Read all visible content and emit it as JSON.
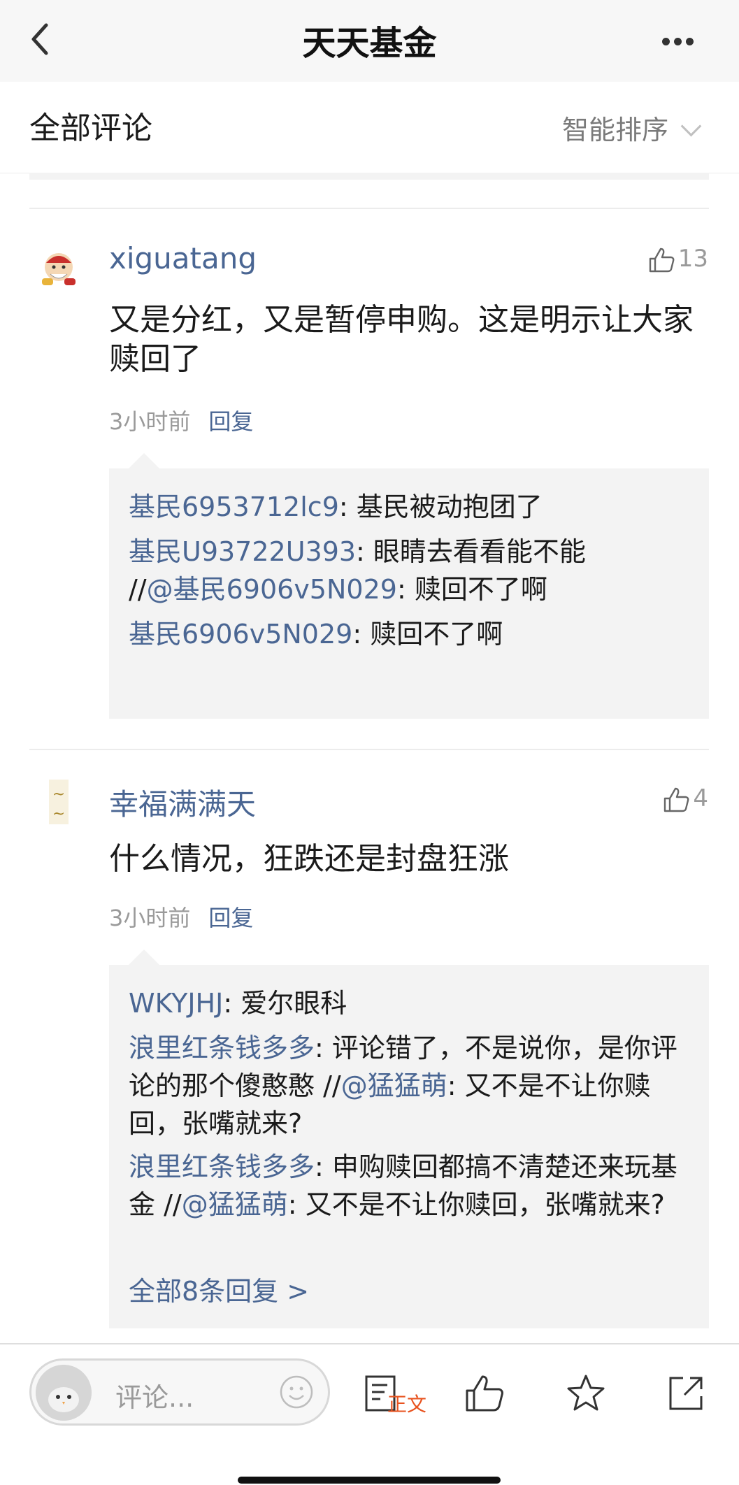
{
  "app": {
    "title": "天天基金"
  },
  "section": {
    "title": "全部评论",
    "sort_label": "智能排序"
  },
  "comments": [
    {
      "user": "xiguatang",
      "likes": "13",
      "content": "又是分红，又是暂停申购。这是明示让大家赎回了",
      "time": "3小时前",
      "reply_label": "回复",
      "replies": [
        {
          "user": "基民6953712lc9",
          "text": ": 基民被动抱团了"
        },
        {
          "user": "基民U93722U393",
          "text_1": ": 眼睛去看看能不能",
          "text_2": " //",
          "mention": "@基民6906v5N029",
          "text_3": ": 赎回不了啊"
        },
        {
          "user": "基民6906v5N029",
          "text": ": 赎回不了啊"
        }
      ]
    },
    {
      "user": "幸福满满天",
      "likes": "4",
      "content": "什么情况，狂跌还是封盘狂涨",
      "time": "3小时前",
      "reply_label": "回复",
      "replies": [
        {
          "user": "WKYJHJ",
          "text": ": 爱尔眼科"
        },
        {
          "user": "浪里红条钱多多",
          "text_1": ": 评论错了，不是说你，是你评论的那个傻憨憨 //",
          "mention": "@猛猛萌",
          "text_2": ": 又不是不让你赎回，张嘴就来?"
        },
        {
          "user": "浪里红条钱多多",
          "text_1": ": 申购赎回都搞不清楚还来玩基金 //",
          "mention": "@猛猛萌",
          "text_2": ": 又不是不让你赎回，张嘴就来?"
        }
      ],
      "all_replies": "全部8条回复 >"
    }
  ],
  "bottom_bar": {
    "comment_placeholder": "评论...",
    "article_label": "正文",
    "icons": [
      "emoji-icon",
      "article-icon",
      "like-icon",
      "star-icon",
      "share-icon"
    ]
  },
  "colors": {
    "link": "#4a6693",
    "accent": "#e8531f",
    "reply_bg": "#f3f3f3"
  }
}
